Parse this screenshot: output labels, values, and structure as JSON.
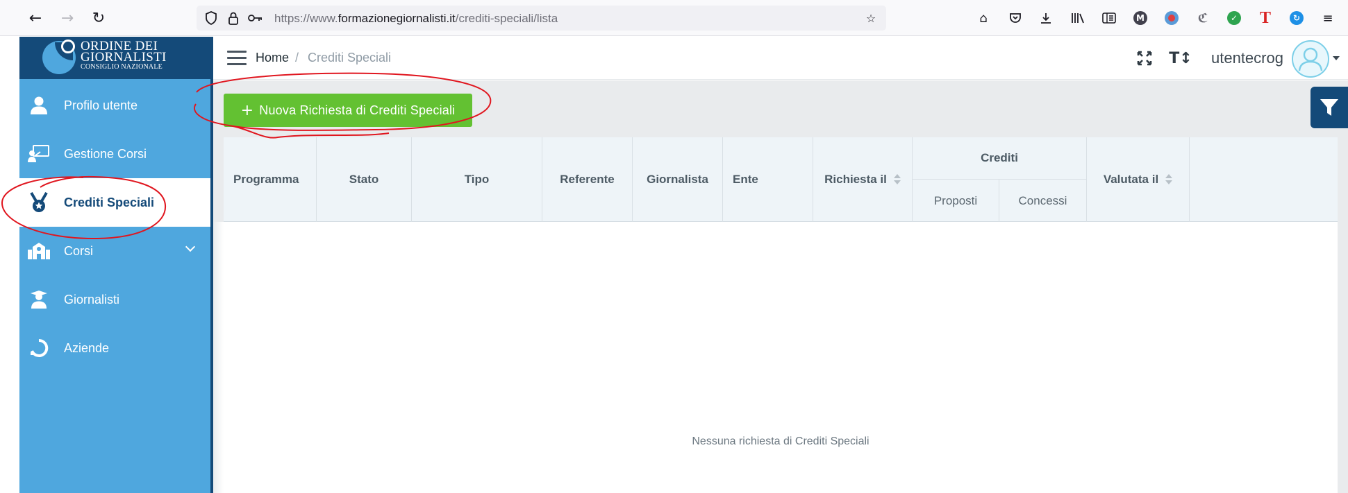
{
  "browser": {
    "url_prefix": "https://www.",
    "url_domain": "formazionegiornalisti.it",
    "url_path": "/crediti-speciali/lista"
  },
  "brand": {
    "line1": "ORDINE DEI",
    "line2": "GIORNALISTI",
    "line3": "CONSIGLIO NAZIONALE"
  },
  "sidebar": {
    "items": [
      {
        "label": "Profilo utente",
        "icon": "user-icon"
      },
      {
        "label": "Gestione Corsi",
        "icon": "presentation-icon"
      },
      {
        "label": "Crediti Speciali",
        "icon": "medal-icon",
        "active": true
      },
      {
        "label": "Corsi",
        "icon": "school-icon"
      },
      {
        "label": "Giornalisti",
        "icon": "graduate-icon"
      },
      {
        "label": "Aziende",
        "icon": "company-icon"
      }
    ]
  },
  "header": {
    "breadcrumb_home": "Home",
    "breadcrumb_sep": "/",
    "breadcrumb_current": "Crediti Speciali",
    "username": "utentecrog"
  },
  "main": {
    "new_button_label": "Nuova Richiesta di Crediti Speciali",
    "table": {
      "columns": [
        "Programma",
        "Stato",
        "Tipo",
        "Referente",
        "Giornalista",
        "Ente",
        "Richiesta il",
        "Crediti",
        "Valutata il"
      ],
      "subcolumns": [
        "Proposti",
        "Concessi"
      ],
      "empty_message": "Nessuna richiesta di Crediti Speciali"
    }
  },
  "colors": {
    "sidebar": "#4fa7de",
    "brand_dark": "#144a79",
    "button_green": "#63c132",
    "annotation_red": "#e0161f"
  }
}
